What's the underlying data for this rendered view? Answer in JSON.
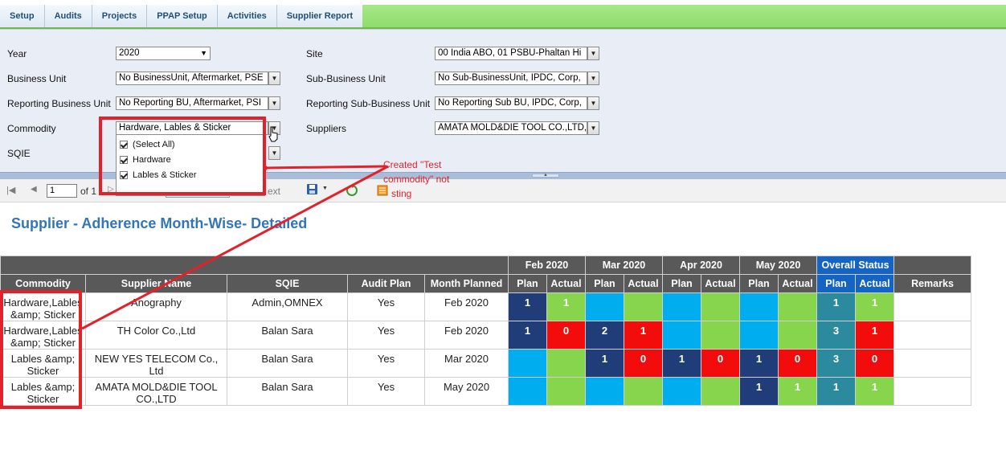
{
  "nav": {
    "tabs": [
      "Setup",
      "Audits",
      "Projects",
      "PPAP Setup",
      "Activities",
      "Supplier Report"
    ]
  },
  "filters": {
    "year_label": "Year",
    "year_value": "2020",
    "business_unit_label": "Business Unit",
    "business_unit_value": "No BusinessUnit, Aftermarket, PSE",
    "reporting_bu_label": "Reporting Business Unit",
    "reporting_bu_value": "No Reporting BU, Aftermarket, PSI",
    "commodity_label": "Commodity",
    "commodity_value": "Hardware, Lables & Sticker",
    "sqie_label": "SQIE",
    "site_label": "Site",
    "site_value": "00 India ABO, 01 PSBU-Phaltan Hi",
    "sub_bu_label": "Sub-Business Unit",
    "sub_bu_value": "No Sub-BusinessUnit, IPDC, Corp,",
    "reporting_sub_bu_label": "Reporting Sub-Business Unit",
    "reporting_sub_bu_value": "No Reporting Sub BU, IPDC, Corp,",
    "suppliers_label": "Suppliers",
    "suppliers_value": "AMATA MOLD&DIE TOOL CO.,LTD,"
  },
  "commodity_dropdown": {
    "options": [
      "(Select All)",
      "Hardware",
      "Lables & Sticker"
    ]
  },
  "toolbar": {
    "page_value": "1",
    "of_label": "of 1",
    "next_label": "ext"
  },
  "annotation": {
    "line1": "Created \"Test",
    "line2": "commodity\" not",
    "line3": "sting"
  },
  "report": {
    "title": "Supplier - Adherence Month-Wise- Detailed",
    "months": [
      "Feb 2020",
      "Mar 2020",
      "Apr 2020",
      "May 2020"
    ],
    "overall_label": "Overall Status",
    "columns": {
      "commodity": "Commodity",
      "supplier": "Supplier Name",
      "sqie": "SQIE",
      "audit_plan": "Audit Plan",
      "month_planned": "Month Planned",
      "plan": "Plan",
      "actual": "Actual",
      "remarks": "Remarks"
    },
    "rows": [
      {
        "commodity": "Hardware,Lables &amp; Sticker",
        "supplier": "Anography",
        "sqie": "Admin,OMNEX",
        "audit_plan": "Yes",
        "month_planned": "Feb 2020",
        "cells": [
          {
            "v": "1",
            "c": "navy"
          },
          {
            "v": "1",
            "c": "green"
          },
          {
            "v": "",
            "c": "sky"
          },
          {
            "v": "",
            "c": "green"
          },
          {
            "v": "",
            "c": "sky"
          },
          {
            "v": "",
            "c": "green"
          },
          {
            "v": "",
            "c": "sky"
          },
          {
            "v": "",
            "c": "green"
          },
          {
            "v": "1",
            "c": "teal"
          },
          {
            "v": "1",
            "c": "green"
          }
        ],
        "remarks": ""
      },
      {
        "commodity": "Hardware,Lables &amp; Sticker",
        "supplier": "TH Color Co.,Ltd",
        "sqie": "Balan Sara",
        "audit_plan": "Yes",
        "month_planned": "Feb 2020",
        "cells": [
          {
            "v": "1",
            "c": "navy"
          },
          {
            "v": "0",
            "c": "red"
          },
          {
            "v": "2",
            "c": "navy"
          },
          {
            "v": "1",
            "c": "red"
          },
          {
            "v": "",
            "c": "sky"
          },
          {
            "v": "",
            "c": "green"
          },
          {
            "v": "",
            "c": "sky"
          },
          {
            "v": "",
            "c": "green"
          },
          {
            "v": "3",
            "c": "teal"
          },
          {
            "v": "1",
            "c": "red"
          }
        ],
        "remarks": ""
      },
      {
        "commodity": "Lables &amp; Sticker",
        "supplier": "NEW YES TELECOM Co., Ltd",
        "sqie": "Balan Sara",
        "audit_plan": "Yes",
        "month_planned": "Mar 2020",
        "cells": [
          {
            "v": "",
            "c": "sky"
          },
          {
            "v": "",
            "c": "green"
          },
          {
            "v": "1",
            "c": "navy"
          },
          {
            "v": "0",
            "c": "red"
          },
          {
            "v": "1",
            "c": "navy"
          },
          {
            "v": "0",
            "c": "red"
          },
          {
            "v": "1",
            "c": "navy"
          },
          {
            "v": "0",
            "c": "red"
          },
          {
            "v": "3",
            "c": "teal"
          },
          {
            "v": "0",
            "c": "red"
          }
        ],
        "remarks": ""
      },
      {
        "commodity": "Lables &amp; Sticker",
        "supplier": "AMATA MOLD&DIE TOOL CO.,LTD",
        "sqie": "Balan Sara",
        "audit_plan": "Yes",
        "month_planned": "May 2020",
        "cells": [
          {
            "v": "",
            "c": "sky"
          },
          {
            "v": "",
            "c": "green"
          },
          {
            "v": "",
            "c": "sky"
          },
          {
            "v": "",
            "c": "green"
          },
          {
            "v": "",
            "c": "sky"
          },
          {
            "v": "",
            "c": "green"
          },
          {
            "v": "1",
            "c": "navy"
          },
          {
            "v": "1",
            "c": "green"
          },
          {
            "v": "1",
            "c": "teal"
          },
          {
            "v": "1",
            "c": "green"
          }
        ],
        "remarks": ""
      }
    ]
  },
  "colors": {
    "navy": "#203d7a",
    "green": "#87d44d",
    "red": "#f20c0c",
    "sky": "#00adef",
    "teal": "#2b8a9e",
    "annotation_red": "#e3212a",
    "title_blue": "#3375b7"
  }
}
